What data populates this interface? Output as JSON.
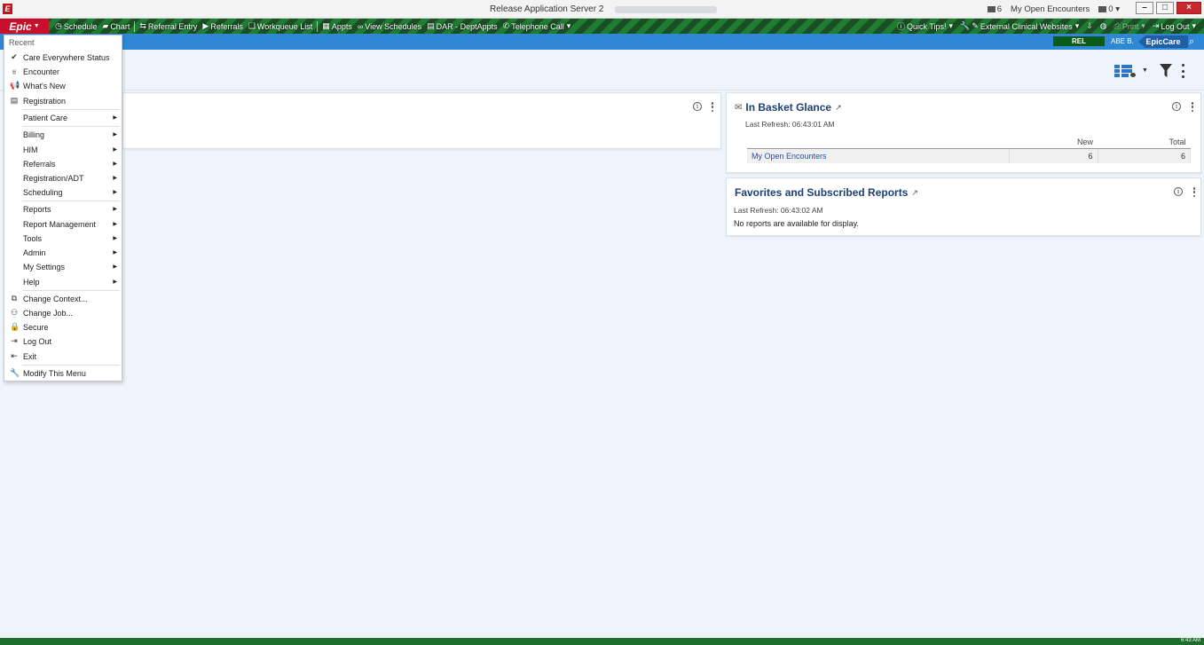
{
  "window": {
    "title": "Release Application Server 2",
    "app_icon": "E",
    "messages_count": "6",
    "open_encounters": "My Open Encounters",
    "secure_count": "0",
    "minimize": "–",
    "maximize": "□",
    "close": "×"
  },
  "toolbar": {
    "epic_label": "Epic",
    "items": [
      {
        "label": "Schedule",
        "icon": "clock-icon"
      },
      {
        "label": "Chart",
        "icon": "folder-icon"
      },
      {
        "label": "Referral Entry",
        "icon": "referral-entry-icon"
      },
      {
        "label": "Referrals",
        "icon": "play-icon"
      },
      {
        "label": "Workqueue List",
        "icon": "workqueue-icon"
      },
      {
        "label": "Appts",
        "icon": "appts-icon"
      },
      {
        "label": "View Schedules",
        "icon": "binoculars-icon"
      },
      {
        "label": "DAR - DeptAppts",
        "icon": "clipboard-icon"
      },
      {
        "label": "Telephone Call",
        "icon": "phone-icon"
      }
    ],
    "right_items": [
      {
        "label": "Quick Tips!",
        "icon": "help-icon"
      },
      {
        "label": "External Clinical Websites",
        "icon": "wrench-icon"
      },
      {
        "label": "Print",
        "icon": "print-icon"
      },
      {
        "label": "Log Out",
        "icon": "logout-icon"
      }
    ]
  },
  "subbar": {
    "environment": "REL",
    "user": "ABE B.",
    "brand": "EpicCare"
  },
  "in_basket": {
    "title": "In Basket Glance",
    "last_refresh": "Last Refresh: 06:43:01 AM",
    "columns": [
      "",
      "New",
      "Total"
    ],
    "rows": [
      {
        "name": "My Open Encounters",
        "new": "6",
        "total": "6"
      }
    ]
  },
  "favorites": {
    "title": "Favorites and Subscribed Reports",
    "last_refresh": "Last Refresh: 06:43:02 AM",
    "empty_message": "No reports are available for display."
  },
  "menu": {
    "recent_label": "Recent",
    "recent_items": [
      {
        "label": "Care Everywhere Status",
        "icon": "check-icon"
      },
      {
        "label": "Encounter",
        "icon": "stethoscope-icon"
      },
      {
        "label": "What's New",
        "icon": "megaphone-icon"
      },
      {
        "label": "Registration",
        "icon": "clipboard-icon"
      }
    ],
    "submenus_1": [
      "Patient Care"
    ],
    "submenus_2": [
      "Billing",
      "HIM",
      "Referrals",
      "Registration/ADT",
      "Scheduling"
    ],
    "submenus_3": [
      "Reports",
      "Report Management",
      "Tools",
      "Admin",
      "My Settings",
      "Help"
    ],
    "actions": [
      {
        "label": "Change Context...",
        "icon": "context-icon"
      },
      {
        "label": "Change Job...",
        "icon": "people-icon"
      },
      {
        "label": "Secure",
        "icon": "lock-icon"
      },
      {
        "label": "Log Out",
        "icon": "logout-icon"
      },
      {
        "label": "Exit",
        "icon": "exit-icon"
      }
    ],
    "modify": {
      "label": "Modify This Menu",
      "icon": "wrench-icon"
    }
  },
  "status": {
    "time": "6:43 AM"
  },
  "colors": {
    "epic_red": "#c8102e",
    "toolbar_green": "#1f7d33",
    "subbar_blue": "#2e88d4",
    "link_blue": "#1d4f9e",
    "title_navy": "#1d3f73"
  }
}
